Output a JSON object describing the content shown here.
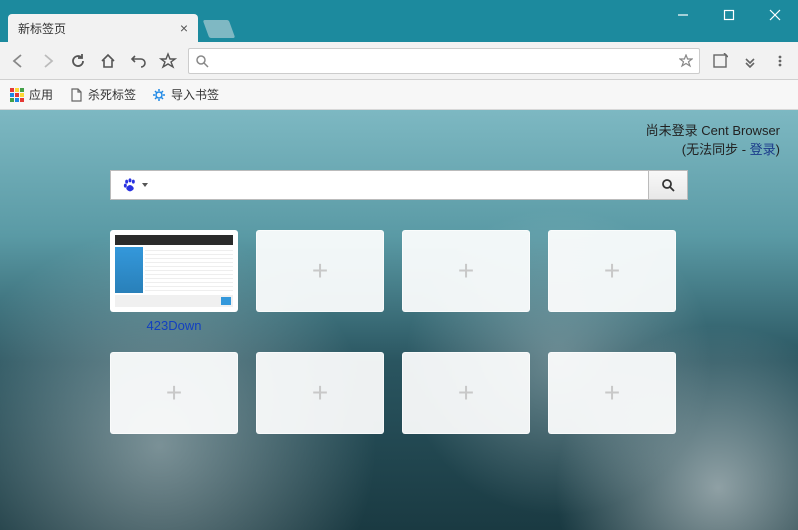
{
  "tab": {
    "title": "新标签页"
  },
  "omnibox": {
    "placeholder": ""
  },
  "bookmarks": {
    "apps": "应用",
    "kill": "杀死标签",
    "import": "导入书签"
  },
  "login": {
    "line1_prefix": "尚未登录 ",
    "line1_brand": "Cent Browser",
    "line2_prefix": "(无法同步 - ",
    "line2_link": "登录",
    "line2_suffix": ")"
  },
  "tiles": [
    {
      "label": "423Down",
      "thumb": true
    },
    {
      "label": "",
      "thumb": false
    },
    {
      "label": "",
      "thumb": false
    },
    {
      "label": "",
      "thumb": false
    },
    {
      "label": "",
      "thumb": false
    },
    {
      "label": "",
      "thumb": false
    },
    {
      "label": "",
      "thumb": false
    },
    {
      "label": "",
      "thumb": false
    }
  ]
}
